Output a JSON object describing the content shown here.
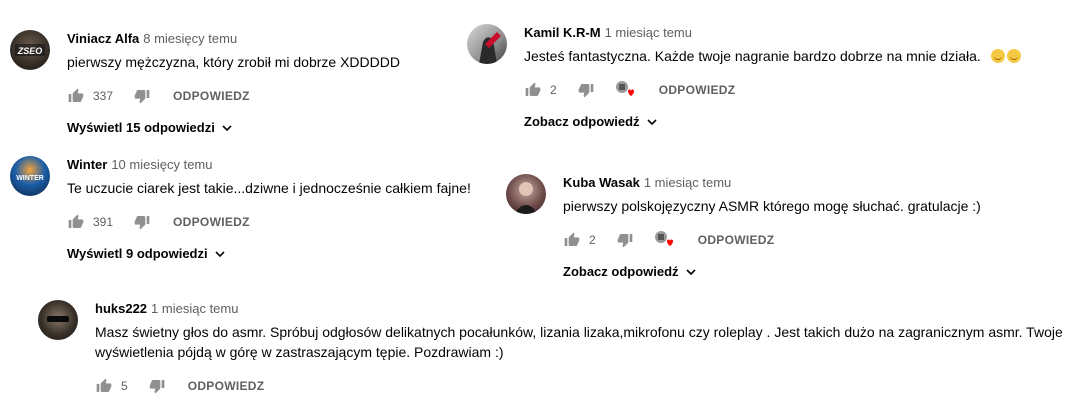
{
  "comments": [
    {
      "author": "Viniacz Alfa",
      "time": "8 miesięcy temu",
      "text": "pierwszy mężczyzna, który zrobił mi dobrze XDDDDD",
      "likes": "337",
      "reply_label": "ODPOWIEDZ",
      "view_replies": "Wyświetl 15 odpowiedzi",
      "avatar_text": "ZSEO"
    },
    {
      "author": "Winter",
      "time": "10 miesięcy temu",
      "text": "Te uczucie ciarek jest takie...dziwne i jednocześnie całkiem fajne!",
      "likes": "391",
      "reply_label": "ODPOWIEDZ",
      "view_replies": "Wyświetl 9 odpowiedzi",
      "avatar_text": "WINTER"
    },
    {
      "author": "huks222",
      "time": "1 miesiąc temu",
      "text": "Masz świetny głos do asmr. Spróbuj odgłosów delikatnych pocałunków, lizania lizaka,mikrofonu czy roleplay . Jest takich dużo na zagranicznym asmr. Twoje wyświetlenia pójdą w górę w zastraszającym tępie. Pozdrawiam :)",
      "likes": "5",
      "reply_label": "ODPOWIEDZ"
    },
    {
      "author": "Kamil K.R-M",
      "time": "1 miesiąc temu",
      "text": "Jesteś fantastyczna. Każde twoje nagranie bardzo dobrze na mnie działa.",
      "likes": "2",
      "reply_label": "ODPOWIEDZ",
      "view_replies": "Zobacz odpowiedź"
    },
    {
      "author": "Kuba Wasak",
      "time": "1 miesiąc temu",
      "text": "pierwszy polskojęzyczny ASMR którego mogę słuchać. gratulacje :)",
      "likes": "2",
      "reply_label": "ODPOWIEDZ",
      "view_replies": "Zobacz odpowiedź"
    }
  ],
  "icons": {
    "like": "thumbs-up-icon",
    "dislike": "thumbs-down-icon",
    "creator_heart": "creator-heart-icon",
    "expand": "chevron-down-icon",
    "emoji": "smiling-face-emoji"
  },
  "colors": {
    "heart": "#ff0000",
    "meta_text": "#606060"
  }
}
